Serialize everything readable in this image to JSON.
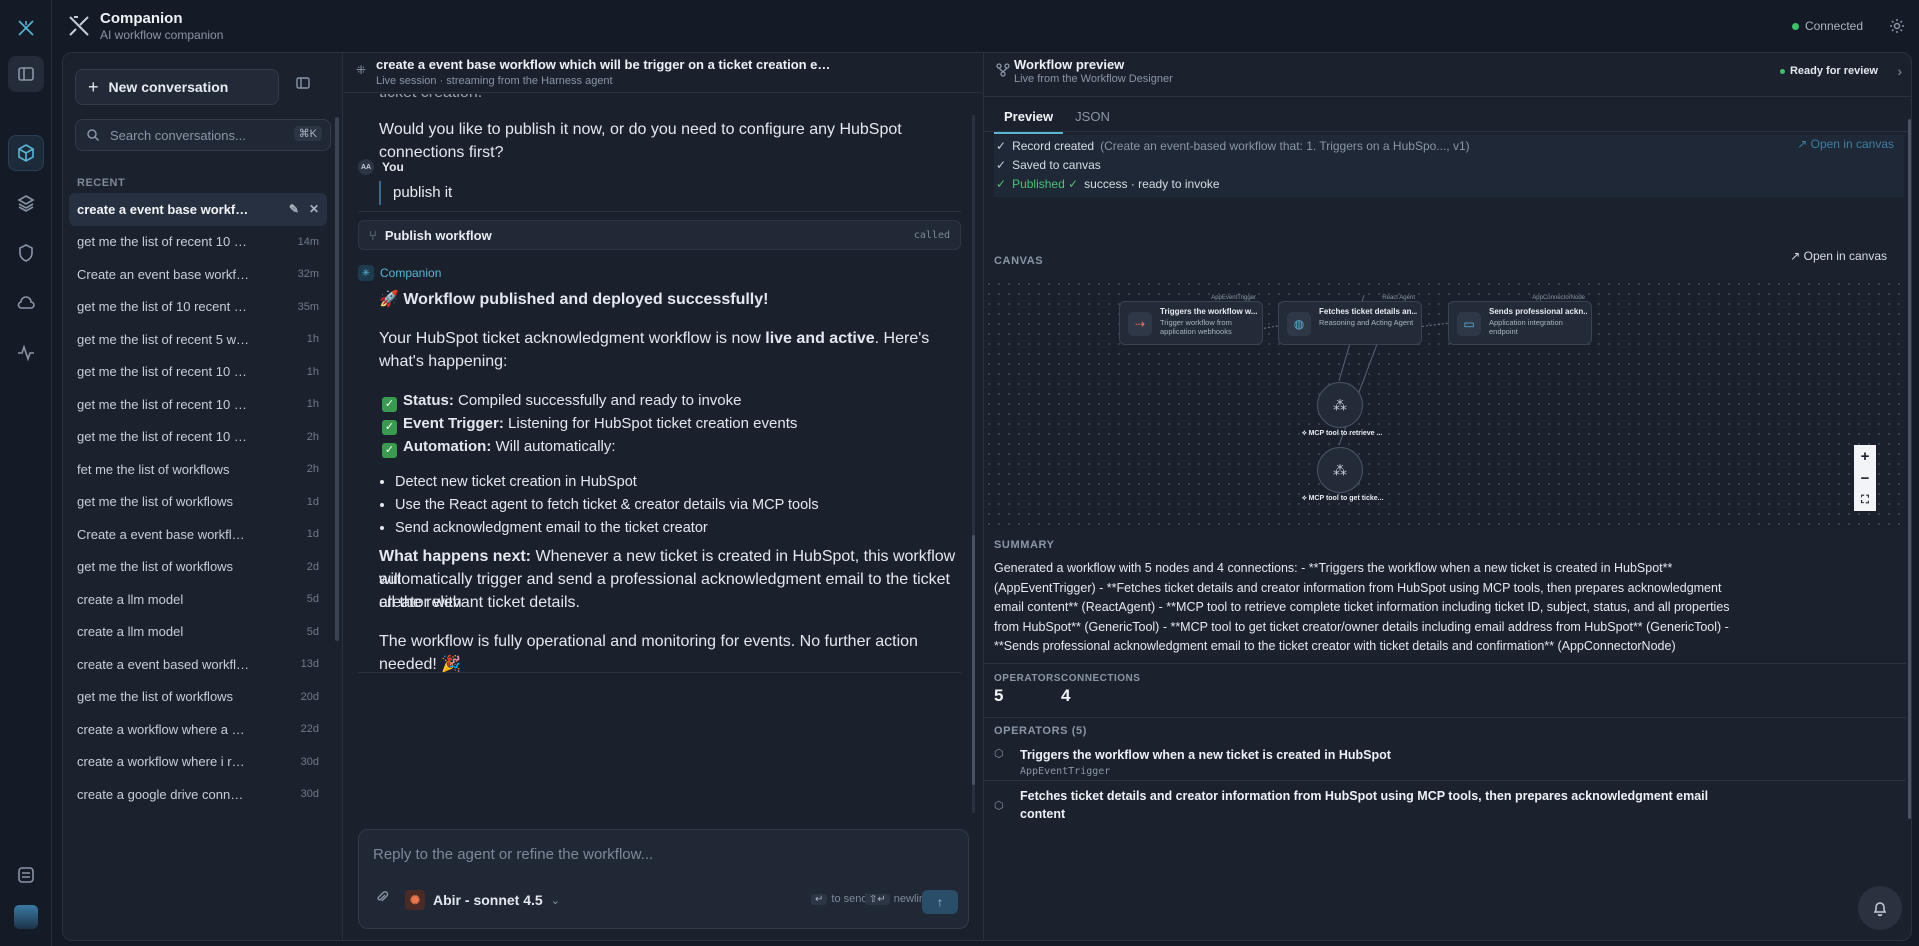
{
  "app": {
    "title": "Companion",
    "subtitle": "AI workflow companion",
    "connection_status": "Connected"
  },
  "sidebar": {
    "new_conversation": "New conversation",
    "search_placeholder": "Search conversations...",
    "search_shortcut": "⌘K",
    "recent_label": "RECENT",
    "conversations": [
      {
        "label": "create a event base workflow w...",
        "ago": ""
      },
      {
        "label": "get me the list of recent 10 wo...",
        "ago": "14m"
      },
      {
        "label": "Create an event base workflo...",
        "ago": "32m"
      },
      {
        "label": "get me the list of 10 recent wo...",
        "ago": "35m"
      },
      {
        "label": "get me the list of recent 5 workf...",
        "ago": "1h"
      },
      {
        "label": "get me the list of recent 10 wor...",
        "ago": "1h"
      },
      {
        "label": "get me the list of recent 10 wor...",
        "ago": "1h"
      },
      {
        "label": "get me the list of recent 10 wor...",
        "ago": "2h"
      },
      {
        "label": "fet me the list of workflows",
        "ago": "2h"
      },
      {
        "label": "get me the list of workflows",
        "ago": "1d"
      },
      {
        "label": "Create a event base workflow t...",
        "ago": "1d"
      },
      {
        "label": "get me the list of workflows",
        "ago": "2d"
      },
      {
        "label": "create a llm model",
        "ago": "5d"
      },
      {
        "label": "create a llm model",
        "ago": "5d"
      },
      {
        "label": "create a event based workflow...",
        "ago": "13d"
      },
      {
        "label": "get me the list of workflows",
        "ago": "20d"
      },
      {
        "label": "create a workflow where a sto...",
        "ago": "22d"
      },
      {
        "label": "create a workflow where i reci...",
        "ago": "30d"
      },
      {
        "label": "create a google drive connecti...",
        "ago": "30d"
      }
    ]
  },
  "chat": {
    "title": "create a event base workflow which will be trigger on a ticket creation event fr...",
    "subtitle": "Live session · streaming from the Harness agent",
    "cutoff_line": "ticket creation.",
    "prev_question": "Would you like to publish it now, or do you need to configure any HubSpot connections first?",
    "user_name": "You",
    "user_initials": "AA",
    "user_message": "publish it",
    "tool_card": {
      "label": "Publish workflow",
      "status": "called"
    },
    "assistant_name": "Companion",
    "heading": "🚀 Workflow published and deployed successfully!",
    "intro_a": "Your HubSpot ticket acknowledgment workflow is now ",
    "intro_bold": "live and active",
    "intro_b": ". Here's",
    "intro_c": "what's happening:",
    "checks": [
      {
        "bold": "Status:",
        "text": " Compiled successfully and ready to invoke"
      },
      {
        "bold": "Event Trigger:",
        "text": " Listening for HubSpot ticket creation events"
      },
      {
        "bold": "Automation:",
        "text": " Will automatically:"
      }
    ],
    "bullets": [
      "Detect new ticket creation in HubSpot",
      "Use the React agent to fetch ticket & creator details via MCP tools",
      "Send acknowledgment email to the ticket creator"
    ],
    "next_bold": "What happens next:",
    "next_1": " Whenever a new ticket is created in HubSpot, this workflow will",
    "next_2": "automatically trigger and send a professional acknowledgment email to the ticket creator with",
    "next_3": "all the relevant ticket details.",
    "closing": "The workflow is fully operational and monitoring for events. No further action needed! 🎉",
    "composer_placeholder": "Reply to the agent or refine the workflow...",
    "model_name": "Abir - sonnet 4.5",
    "send_hint": "to send",
    "newline_hint": "newline",
    "send_key": "↵",
    "newline_key": "⇧↵"
  },
  "preview": {
    "title": "Workflow preview",
    "subtitle": "Live from the Workflow Designer",
    "badge": "Ready for review",
    "tabs": [
      "Preview",
      "JSON"
    ],
    "status": {
      "record": "Record created",
      "record_detail": "(Create an event-based workflow that: 1. Triggers on a HubSpo..., v1)",
      "saved": "Saved to canvas",
      "published": "Published ✓",
      "published_detail": "success · ready to invoke",
      "open_canvas": "Open in canvas"
    },
    "canvas_label": "CANVAS",
    "canvas_open": "Open in canvas",
    "nodes": [
      {
        "badge": "AppEventTrigger",
        "title": "Triggers the workflow w...",
        "desc": "Trigger workflow from application webhooks"
      },
      {
        "badge": "React Agent",
        "title": "Fetches ticket details an...",
        "desc": "Reasoning and Acting Agent"
      },
      {
        "badge": "AppConnectorNode",
        "title": "Sends professional ackn...",
        "desc": "Application integration endpoint"
      }
    ],
    "tools": [
      {
        "label": "MCP tool to retrieve ..."
      },
      {
        "label": "MCP tool to get ticke..."
      }
    ],
    "summary_label": "SUMMARY",
    "summary": "Generated a workflow with 5 nodes and 4 connections: - **Triggers the workflow when a new ticket is created in HubSpot** (AppEventTrigger) - **Fetches ticket details and creator information from HubSpot using MCP tools, then prepares acknowledgment email content** (ReactAgent) - **MCP tool to retrieve complete ticket information including ticket ID, subject, status, and all properties from HubSpot** (GenericTool) - **MCP tool to get ticket creator/owner details including email address from HubSpot** (GenericTool) - **Sends professional acknowledgment email to the ticket creator with ticket details and confirmation** (AppConnectorNode)",
    "operators_label": "OPERATORS",
    "operators_value": "5",
    "connections_label": "CONNECTIONS",
    "connections_value": "4",
    "operators_list_label": "OPERATORS (5)",
    "operators": [
      {
        "title": "Triggers the workflow when a new ticket is created in HubSpot",
        "kind": "AppEventTrigger"
      },
      {
        "title": "Fetches ticket details and creator information from HubSpot using MCP tools, then prepares acknowledgment email content",
        "kind": ""
      }
    ]
  }
}
